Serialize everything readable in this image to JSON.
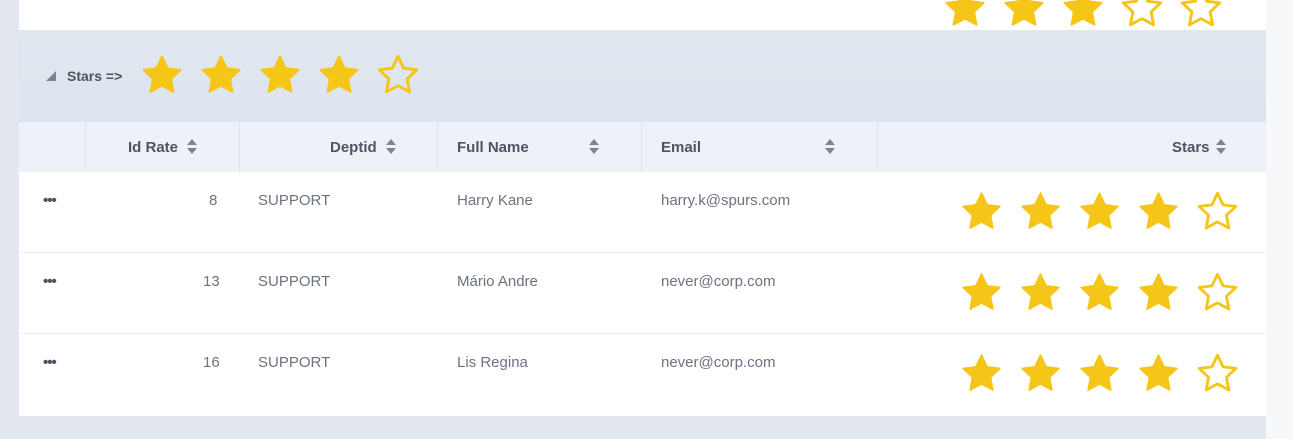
{
  "group": {
    "label": "Stars =>",
    "stars": 4,
    "max_stars": 5
  },
  "columns": {
    "id_rate": "Id Rate",
    "deptid": "Deptid",
    "full_name": "Full Name",
    "email": "Email",
    "stars": "Stars"
  },
  "rows": [
    {
      "menu": "•••",
      "id_rate": "8",
      "deptid": "SUPPORT",
      "full_name": "Harry Kane",
      "email": "harry.k@spurs.com",
      "stars": 4
    },
    {
      "menu": "•••",
      "id_rate": "13",
      "deptid": "SUPPORT",
      "full_name": "Mário Andre",
      "email": "never@corp.com",
      "stars": 4
    },
    {
      "menu": "•••",
      "id_rate": "16",
      "deptid": "SUPPORT",
      "full_name": "Lis Regina",
      "email": "never@corp.com",
      "stars": 4
    }
  ],
  "previous_group_stars": 3,
  "colors": {
    "star": "#f5c518",
    "header_bg": "#eef2f8",
    "group_bg": "#e1e7ef"
  },
  "icons": {
    "filled": "star-filled-icon",
    "empty": "star-empty-icon",
    "toggle": "collapse-triangle-icon",
    "menu": "more-dots-icon",
    "sort": "sort-arrows-icon"
  }
}
